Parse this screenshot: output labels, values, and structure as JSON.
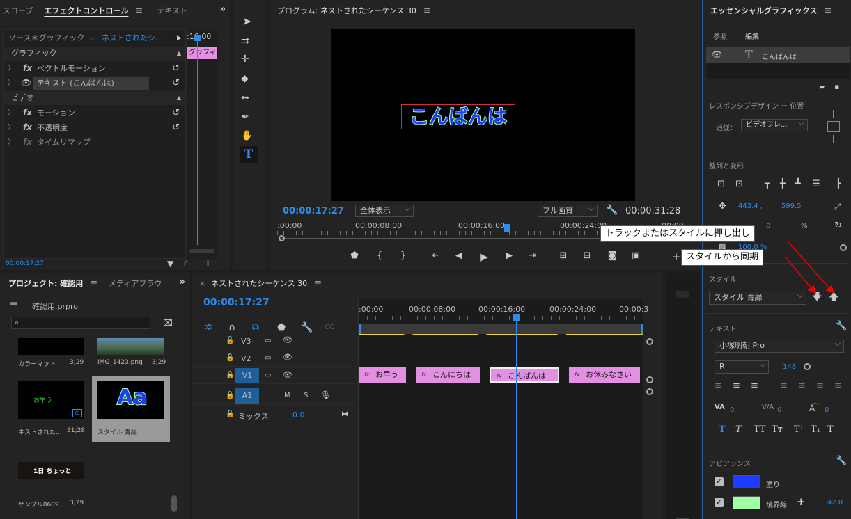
{
  "effect_controls": {
    "tabs": [
      "スコープ",
      "エフェクトコントロール",
      "テキスト"
    ],
    "source_label": "ソース＊グラフィック",
    "sequence_label": "ネストされたシ...",
    "timecode_header": ":16:00",
    "clip_label": "グラフィ",
    "section_graphic": "グラフィック",
    "section_video": "ビデオ",
    "items": [
      "ベクトルモーション",
      "テキスト (こんばんは)",
      "モーション",
      "不透明度",
      "タイムリマップ"
    ],
    "timecode": "00:00:17:27"
  },
  "program": {
    "title": "プログラム: ネストされたシーケンス 30",
    "overlay_text": "こんばんは",
    "timecode": "00:00:17:27",
    "zoom": "全体表示",
    "quality": "フル画質",
    "duration": "00:00:31:28",
    "ruler": [
      ":00:00",
      "00:00:08:00",
      "00:00:16:00",
      "00:00:24:00",
      "00:00:"
    ]
  },
  "project": {
    "tabs": [
      "プロジェクト: 確認用",
      "メディアブラウ"
    ],
    "file_name": "確認用.prproj",
    "search_placeholder": "",
    "items": [
      {
        "name": "カラーマット",
        "duration": "3;29"
      },
      {
        "name": "IMG_1423.png",
        "duration": "3;29"
      },
      {
        "name": "ネストされた...",
        "duration": "31;28",
        "thumb_text": "お早う"
      },
      {
        "name": "スタイル 青緑",
        "duration": "",
        "thumb_text": "Aa"
      },
      {
        "name": "サンプル0609....",
        "duration": "3;29",
        "thumb_text": "1日 ちょっと"
      }
    ]
  },
  "timeline": {
    "tab": "ネストされたシーケンス 30",
    "timecode": "00:00:17:27",
    "ruler": [
      ":00:00",
      "00:00:08:00",
      "00:00:16:00",
      "00:00:24:00",
      "00:00:3"
    ],
    "tracks": [
      "V3",
      "V2",
      "V1",
      "A1"
    ],
    "audio_buttons": [
      "M",
      "S"
    ],
    "mix_label": "ミックス",
    "mix_value": "0.0",
    "clips": [
      "お早う",
      "こんにちは",
      "こんばんは",
      "お休みなさい"
    ]
  },
  "essential_graphics": {
    "title": "エッセンシャルグラフィックス",
    "tabs": [
      "参照",
      "編集"
    ],
    "layer_name": "こんばんは",
    "responsive_label": "レスポンシブデザイン ー 位置",
    "follow_label": "追従：",
    "follow_value": "ビデオフレ...",
    "align_label": "整列と変形",
    "pos_x": "443.4 ,",
    "pos_y": "599.5",
    "opacity_value": "0",
    "percent": "%",
    "scale_value": "100.0 %",
    "style_label": "スタイル",
    "style_value": "スタイル 青緑",
    "text_label": "テキスト",
    "font": "小塚明朝 Pro",
    "weight": "R",
    "size": "148",
    "kerning": "0",
    "tracking": "0",
    "baseline": "0",
    "style_buttons": [
      "T",
      "T",
      "TT",
      "Tт",
      "T¹",
      "T₁",
      "T"
    ],
    "appearance_label": "アピアランス",
    "fill_label": "塗り",
    "stroke_label": "境界線",
    "stroke_value": "42.0",
    "fill_color": "#1e3cff",
    "stroke_color": "#a0ffa0"
  },
  "callouts": {
    "push": "トラックまたはスタイルに押し出し",
    "sync": "スタイルから同期"
  }
}
